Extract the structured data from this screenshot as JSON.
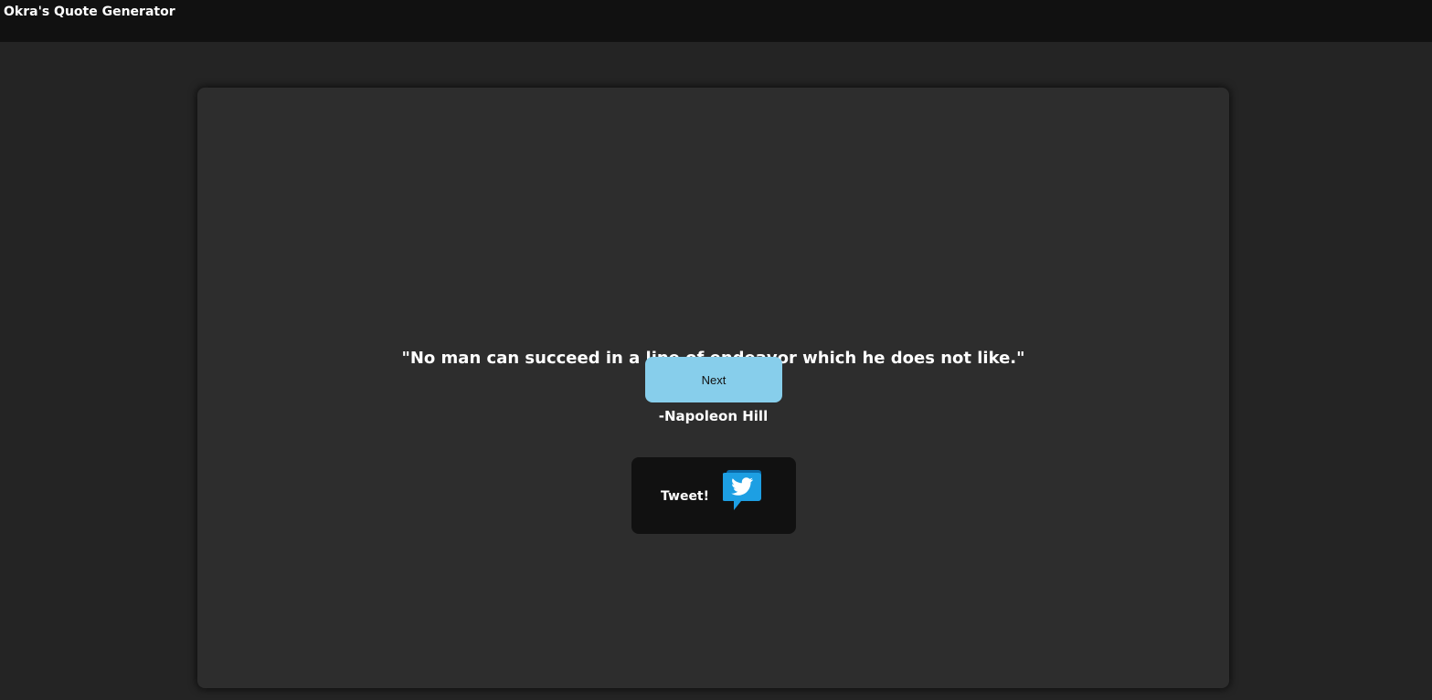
{
  "header": {
    "title": "Okra's Quote Generator"
  },
  "quote": {
    "text": "\"No man can succeed in a line of endeavor which he does not like.\"",
    "author": "-Napoleon Hill"
  },
  "buttons": {
    "next_label": "Next",
    "tweet_label": "Tweet!",
    "tweet_icon": "twitter-bird-speech-bubble-icon"
  },
  "colors": {
    "page_background": "#242424",
    "header_background": "#111111",
    "card_background": "#2d2d2d",
    "next_button": "#87ceeb",
    "tweet_button": "#111111",
    "twitter_blue": "#1da1f2",
    "text": "#ffffff"
  }
}
